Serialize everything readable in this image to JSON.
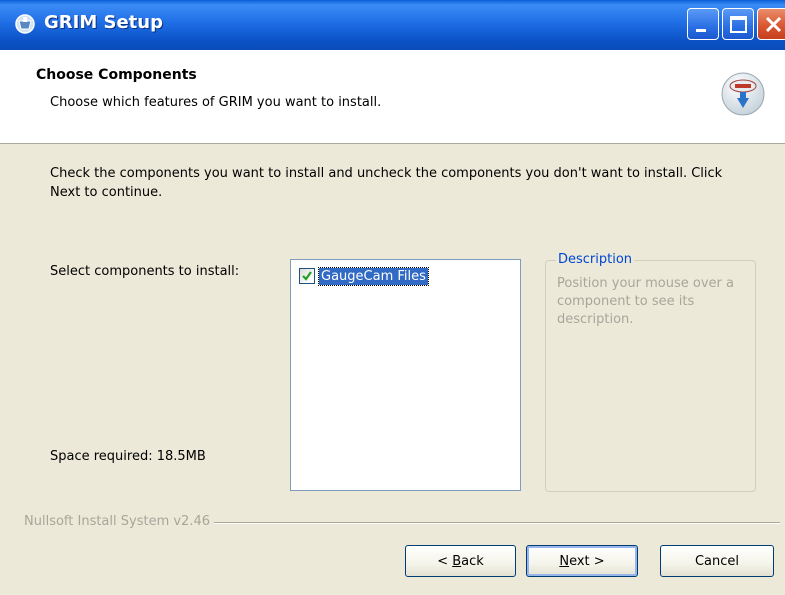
{
  "window": {
    "title": "GRIM Setup"
  },
  "header": {
    "title": "Choose Components",
    "subtitle": "Choose which features of GRIM you want to install."
  },
  "intro": {
    "text": "Check the components you want to install and uncheck the components you don't want to install. Click Next to continue."
  },
  "components": {
    "select_label": "Select components to install:",
    "items": [
      {
        "label": "GaugeCam Files",
        "checked": true
      }
    ],
    "space_required": "Space required: 18.5MB"
  },
  "description": {
    "title": "Description",
    "text": "Position your mouse over a component to see its description."
  },
  "footer": {
    "branding": "Nullsoft Install System v2.46",
    "back_prefix": "< ",
    "back_accel": "B",
    "back_rest": "ack",
    "next_accel": "N",
    "next_rest": "ext >",
    "cancel_label": "Cancel"
  },
  "colors": {
    "titlebar": "#0a5fd8",
    "dialog_bg": "#ece9d8",
    "accent_description": "#0046d5",
    "close_button": "#d8542d"
  }
}
